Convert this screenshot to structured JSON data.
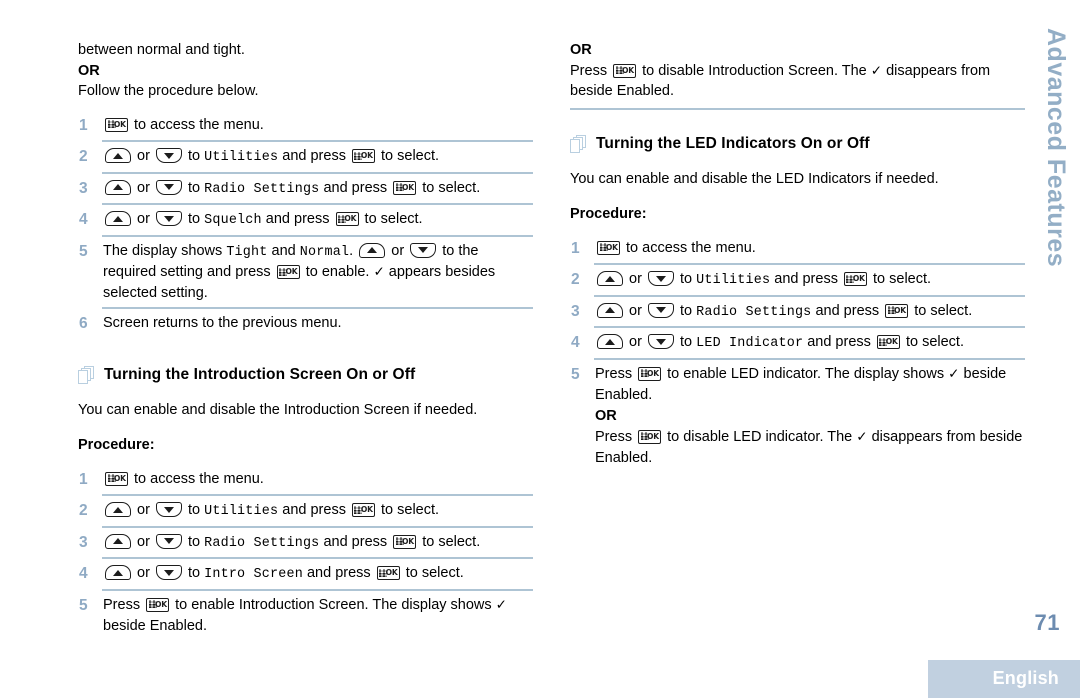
{
  "document": {
    "page_number": "71",
    "language": "English",
    "side_tab": "Advanced Features",
    "accent_color": "#aec4d4",
    "number_color": "#8faac4",
    "side_tab_color": "#93aec6",
    "band_color": "#c1d0e0"
  },
  "icons": {
    "ok_key_label": "OK",
    "pages": "pages-stack-icon",
    "up_key": "arrow-up-key-icon",
    "down_key": "arrow-down-key-icon",
    "checkmark": "✓"
  },
  "left_column": {
    "continued_text": "between normal and tight.",
    "or_label": "OR",
    "follow_text": "Follow the procedure below.",
    "steps": [
      {
        "num": "1",
        "parts": [
          {
            "t": "key-ok"
          },
          {
            "t": "text",
            "v": " to access the menu."
          }
        ]
      },
      {
        "num": "2",
        "parts": [
          {
            "t": "key-up"
          },
          {
            "t": "text",
            "v": " or "
          },
          {
            "t": "key-down"
          },
          {
            "t": "text",
            "v": " to "
          },
          {
            "t": "mono",
            "v": "Utilities"
          },
          {
            "t": "text",
            "v": " and press "
          },
          {
            "t": "key-ok"
          },
          {
            "t": "text",
            "v": " to select."
          }
        ]
      },
      {
        "num": "3",
        "parts": [
          {
            "t": "key-up"
          },
          {
            "t": "text",
            "v": " or "
          },
          {
            "t": "key-down"
          },
          {
            "t": "text",
            "v": " to "
          },
          {
            "t": "mono",
            "v": "Radio Settings"
          },
          {
            "t": "text",
            "v": " and press "
          },
          {
            "t": "key-ok"
          },
          {
            "t": "text",
            "v": " to select."
          }
        ]
      },
      {
        "num": "4",
        "parts": [
          {
            "t": "key-up"
          },
          {
            "t": "text",
            "v": " or "
          },
          {
            "t": "key-down"
          },
          {
            "t": "text",
            "v": " to "
          },
          {
            "t": "mono",
            "v": "Squelch"
          },
          {
            "t": "text",
            "v": " and press "
          },
          {
            "t": "key-ok"
          },
          {
            "t": "text",
            "v": " to select."
          }
        ]
      },
      {
        "num": "5",
        "parts": [
          {
            "t": "text",
            "v": "The display shows "
          },
          {
            "t": "mono",
            "v": "Tight"
          },
          {
            "t": "text",
            "v": " and "
          },
          {
            "t": "mono",
            "v": "Normal"
          },
          {
            "t": "text",
            "v": ". "
          },
          {
            "t": "key-up"
          },
          {
            "t": "text",
            "v": " or "
          },
          {
            "t": "key-down"
          },
          {
            "t": "text",
            "v": " to the required setting and press "
          },
          {
            "t": "key-ok"
          },
          {
            "t": "text",
            "v": " to enable. "
          },
          {
            "t": "check",
            "v": "✓"
          },
          {
            "t": "text",
            "v": " appears besides selected setting."
          }
        ]
      },
      {
        "num": "6",
        "parts": [
          {
            "t": "text",
            "v": "Screen returns to the previous menu."
          }
        ]
      }
    ],
    "section": {
      "title": "Turning the Introduction Screen On or Off",
      "intro": "You can enable and disable the Introduction Screen if needed.",
      "procedure_label": "Procedure:",
      "steps": [
        {
          "num": "1",
          "parts": [
            {
              "t": "key-ok"
            },
            {
              "t": "text",
              "v": " to access the menu."
            }
          ]
        },
        {
          "num": "2",
          "parts": [
            {
              "t": "key-up"
            },
            {
              "t": "text",
              "v": " or "
            },
            {
              "t": "key-down"
            },
            {
              "t": "text",
              "v": " to "
            },
            {
              "t": "mono",
              "v": "Utilities"
            },
            {
              "t": "text",
              "v": " and press "
            },
            {
              "t": "key-ok"
            },
            {
              "t": "text",
              "v": " to select."
            }
          ]
        },
        {
          "num": "3",
          "parts": [
            {
              "t": "key-up"
            },
            {
              "t": "text",
              "v": " or "
            },
            {
              "t": "key-down"
            },
            {
              "t": "text",
              "v": " to "
            },
            {
              "t": "mono",
              "v": "Radio Settings"
            },
            {
              "t": "text",
              "v": " and press "
            },
            {
              "t": "key-ok"
            },
            {
              "t": "text",
              "v": " to select."
            }
          ]
        },
        {
          "num": "4",
          "parts": [
            {
              "t": "key-up"
            },
            {
              "t": "text",
              "v": " or "
            },
            {
              "t": "key-down"
            },
            {
              "t": "text",
              "v": " to "
            },
            {
              "t": "mono",
              "v": "Intro Screen"
            },
            {
              "t": "text",
              "v": " and press "
            },
            {
              "t": "key-ok"
            },
            {
              "t": "text",
              "v": " to select."
            }
          ]
        },
        {
          "num": "5",
          "parts": [
            {
              "t": "text",
              "v": "Press "
            },
            {
              "t": "key-ok"
            },
            {
              "t": "text",
              "v": " to enable Introduction Screen. The display shows "
            },
            {
              "t": "check",
              "v": "✓"
            },
            {
              "t": "text",
              "v": " beside Enabled."
            }
          ]
        }
      ]
    }
  },
  "right_column": {
    "or_label": "OR",
    "disable_intro_parts": [
      {
        "t": "text",
        "v": "Press "
      },
      {
        "t": "key-ok"
      },
      {
        "t": "text",
        "v": " to disable Introduction Screen. The "
      },
      {
        "t": "check",
        "v": "✓"
      },
      {
        "t": "text",
        "v": " disappears from beside Enabled."
      }
    ],
    "section": {
      "title": "Turning the LED Indicators On or Off",
      "intro": "You can enable and disable the LED Indicators if needed.",
      "procedure_label": "Procedure:",
      "steps": [
        {
          "num": "1",
          "parts": [
            {
              "t": "key-ok"
            },
            {
              "t": "text",
              "v": " to access the menu."
            }
          ]
        },
        {
          "num": "2",
          "parts": [
            {
              "t": "key-up"
            },
            {
              "t": "text",
              "v": " or "
            },
            {
              "t": "key-down"
            },
            {
              "t": "text",
              "v": " to "
            },
            {
              "t": "mono",
              "v": "Utilities"
            },
            {
              "t": "text",
              "v": " and press "
            },
            {
              "t": "key-ok"
            },
            {
              "t": "text",
              "v": " to select."
            }
          ]
        },
        {
          "num": "3",
          "parts": [
            {
              "t": "key-up"
            },
            {
              "t": "text",
              "v": " or "
            },
            {
              "t": "key-down"
            },
            {
              "t": "text",
              "v": " to "
            },
            {
              "t": "mono",
              "v": "Radio Settings"
            },
            {
              "t": "text",
              "v": " and press "
            },
            {
              "t": "key-ok"
            },
            {
              "t": "text",
              "v": " to select."
            }
          ]
        },
        {
          "num": "4",
          "parts": [
            {
              "t": "key-up"
            },
            {
              "t": "text",
              "v": " or "
            },
            {
              "t": "key-down"
            },
            {
              "t": "text",
              "v": " to "
            },
            {
              "t": "mono",
              "v": "LED Indicator"
            },
            {
              "t": "text",
              "v": " and press "
            },
            {
              "t": "key-ok"
            },
            {
              "t": "text",
              "v": " to select."
            }
          ]
        },
        {
          "num": "5",
          "parts": [
            {
              "t": "text",
              "v": "Press "
            },
            {
              "t": "key-ok"
            },
            {
              "t": "text",
              "v": " to enable LED indicator. The display shows "
            },
            {
              "t": "check",
              "v": "✓"
            },
            {
              "t": "text",
              "v": " beside Enabled."
            },
            {
              "t": "br"
            },
            {
              "t": "bold",
              "v": "OR"
            },
            {
              "t": "br"
            },
            {
              "t": "text",
              "v": "Press "
            },
            {
              "t": "key-ok"
            },
            {
              "t": "text",
              "v": " to disable LED indicator. The "
            },
            {
              "t": "check",
              "v": "✓"
            },
            {
              "t": "text",
              "v": " disappears from beside Enabled."
            }
          ]
        }
      ]
    }
  }
}
